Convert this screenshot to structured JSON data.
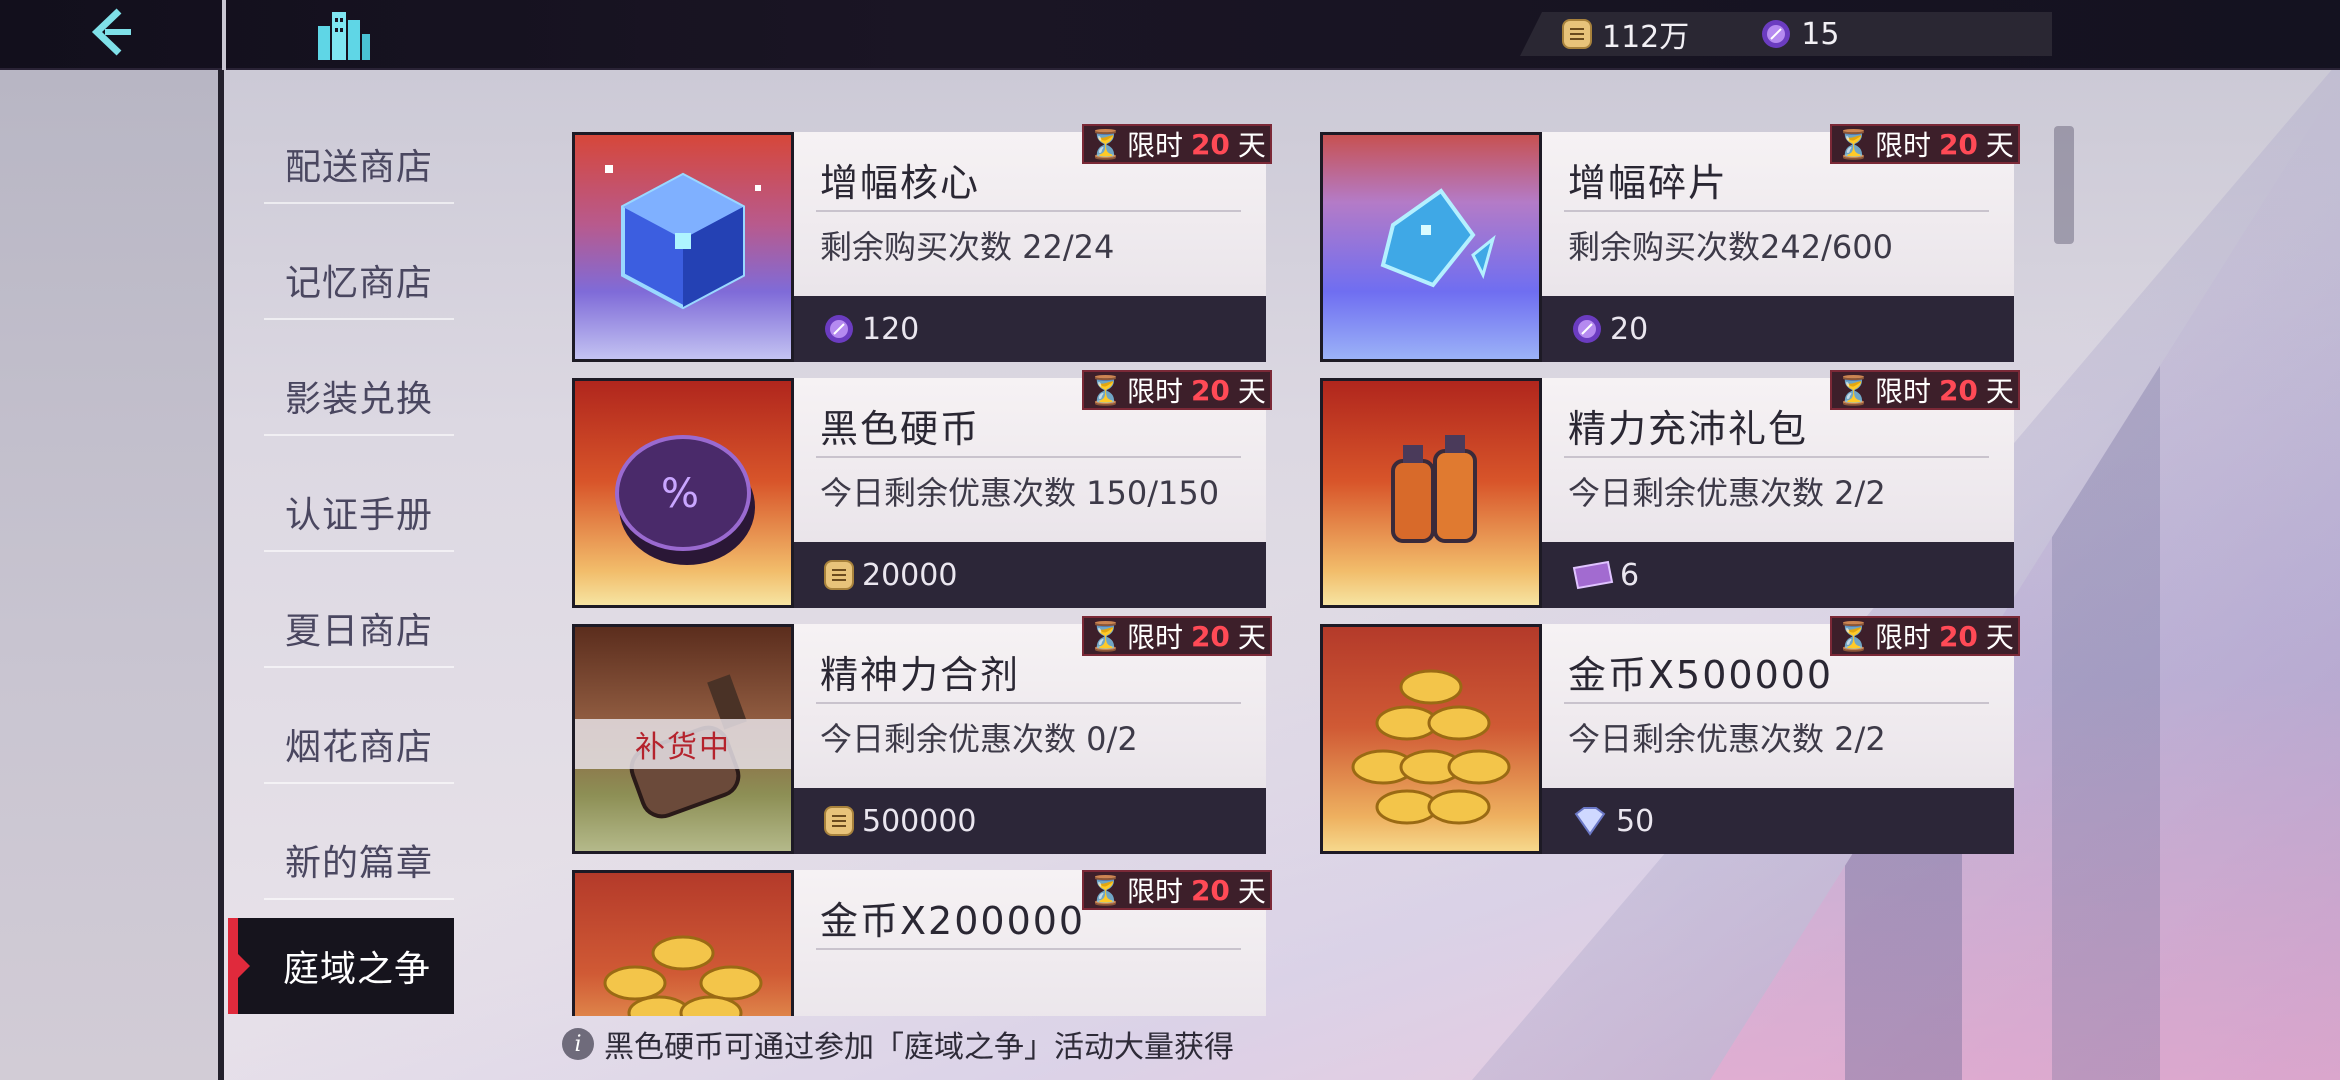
{
  "currency": {
    "coin_amount": "112万",
    "gem_amount": "15"
  },
  "sidebar": {
    "items": [
      {
        "label": "配送商店"
      },
      {
        "label": "记忆商店"
      },
      {
        "label": "影装兑换"
      },
      {
        "label": "认证手册"
      },
      {
        "label": "夏日商店"
      },
      {
        "label": "烟花商店"
      },
      {
        "label": "新的篇章"
      },
      {
        "label": "庭域之争"
      }
    ],
    "active_index": 7
  },
  "tag": {
    "prefix": "限时",
    "days": "20",
    "unit": "天"
  },
  "items": [
    {
      "title": "增幅核心",
      "sub": "剩余购买次数  22/24",
      "price": "120",
      "price_icon": "purple-gem-icon"
    },
    {
      "title": "增幅碎片",
      "sub": "剩余购买次数242/600",
      "price": "20",
      "price_icon": "purple-gem-icon"
    },
    {
      "title": "黑色硬币",
      "sub": "今日剩余优惠次数 150/150",
      "price": "20000",
      "price_icon": "gold-coin-icon"
    },
    {
      "title": "精力充沛礼包",
      "sub": "今日剩余优惠次数 2/2",
      "price": "6",
      "price_icon": "ticket-icon"
    },
    {
      "title": "精神力合剂",
      "sub": "今日剩余优惠次数 0/2",
      "price": "500000",
      "price_icon": "gold-coin-icon",
      "status": "补货中"
    },
    {
      "title": "金币X500000",
      "sub": "今日剩余优惠次数 2/2",
      "price": "50",
      "price_icon": "diamond-icon"
    },
    {
      "title": "金币X200000"
    }
  ],
  "footer": {
    "note": "黑色硬币可通过参加「庭域之争」活动大量获得"
  }
}
